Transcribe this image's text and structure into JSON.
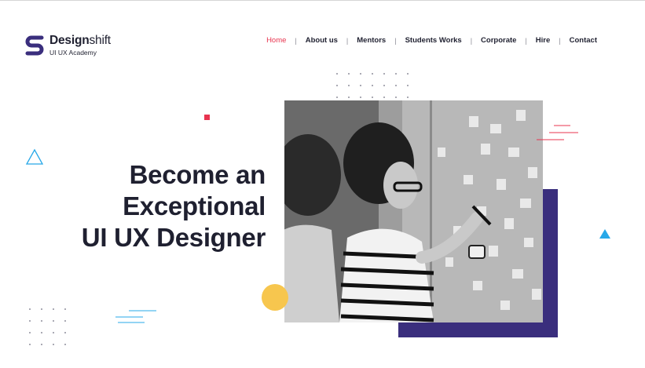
{
  "logo": {
    "brand_bold": "Design",
    "brand_light": "shift",
    "tagline": "UI UX Academy",
    "icon": "designshift-s-logo-icon",
    "color": "#3a2e7d"
  },
  "nav": {
    "items": [
      {
        "label": "Home",
        "active": true
      },
      {
        "label": "About us",
        "active": false
      },
      {
        "label": "Mentors",
        "active": false
      },
      {
        "label": "Students Works",
        "active": false
      },
      {
        "label": "Corporate",
        "active": false
      },
      {
        "label": "Hire",
        "active": false
      },
      {
        "label": "Contact",
        "active": false
      }
    ],
    "separator": "|",
    "active_color": "#e8344f"
  },
  "hero": {
    "headline_lines": [
      "Become an",
      "Exceptional",
      "UI UX Designer"
    ],
    "photo_alt": "Two people working on sticky notes on a glass wall"
  },
  "colors": {
    "accent_red": "#e8344f",
    "accent_purple": "#3a2e7d",
    "accent_yellow": "#f7c64e",
    "accent_blue": "#27a8e8"
  }
}
